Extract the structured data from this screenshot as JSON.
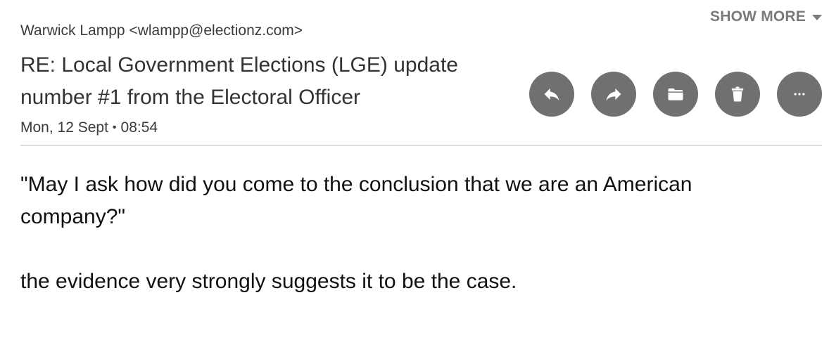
{
  "email": {
    "sender": "Warwick Lampp <wlampp@electionz.com>",
    "subject": "RE: Local Government Elections (LGE) update number #1 from the Electoral Officer",
    "date": "Mon, 12 Sept",
    "time": "08:54",
    "show_more": "SHOW MORE"
  },
  "actions": [
    {
      "name": "reply",
      "icon": "reply-icon"
    },
    {
      "name": "forward",
      "icon": "forward-icon"
    },
    {
      "name": "move-to-folder",
      "icon": "folder-icon"
    },
    {
      "name": "delete",
      "icon": "trash-icon"
    },
    {
      "name": "more",
      "icon": "more-horizontal-icon"
    }
  ],
  "body": {
    "quote": "\"May I ask how did you come to the conclusion that we are an American company?\"",
    "reply": "the evidence very strongly suggests it to be the case."
  },
  "colors": {
    "action_button_bg": "#707070",
    "show_more_text": "#7a7a7a",
    "divider": "#dddddd"
  }
}
